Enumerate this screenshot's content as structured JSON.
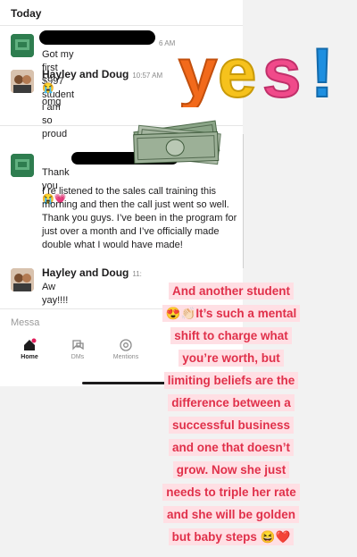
{
  "header": {
    "section": "Today"
  },
  "messages": [
    {
      "text": "Got my first $997 student",
      "time_fragment": "6 AM"
    },
    {
      "name": "Hayley and Doug",
      "time": "10:57 AM",
      "text1": "😭omg",
      "text2": "i am so proud"
    },
    {
      "text1": "Thank you 😭💗",
      "text2": "I re listened to the sales call training this morning and then the call just went so well. Thank you guys. I’ve been in the program for just over a month and I’ve officially made double what I would have made!"
    },
    {
      "name": "Hayley and Doug",
      "time_fragment": "11:",
      "text": "Aw yay!!!!"
    }
  ],
  "composer": {
    "placeholder": "Messa"
  },
  "tabs": [
    {
      "label": "Home",
      "icon": "home-icon",
      "active": true
    },
    {
      "label": "DMs",
      "icon": "dm-icon",
      "active": false
    },
    {
      "label": "Mentions",
      "icon": "at-icon",
      "active": false
    }
  ],
  "stickers": {
    "yes": "yes!"
  },
  "caption": {
    "lines": [
      "And another student",
      "😍👏🏻It’s such a mental",
      "shift to charge what",
      "you’re worth, but",
      "limiting beliefs are the",
      "difference between a",
      "successful business",
      "and one that doesn’t",
      "grow. Now she just",
      "needs to triple her rate",
      "and she will be golden",
      "but baby steps 😆❤️"
    ]
  },
  "colors": {
    "yes_orange": "#f26a1b",
    "yes_yellow": "#f6c21c",
    "yes_pink": "#f04a8a",
    "yes_blue": "#1e8fe0",
    "caption_red": "#e0304a",
    "caption_bg": "#ffdfe4"
  }
}
